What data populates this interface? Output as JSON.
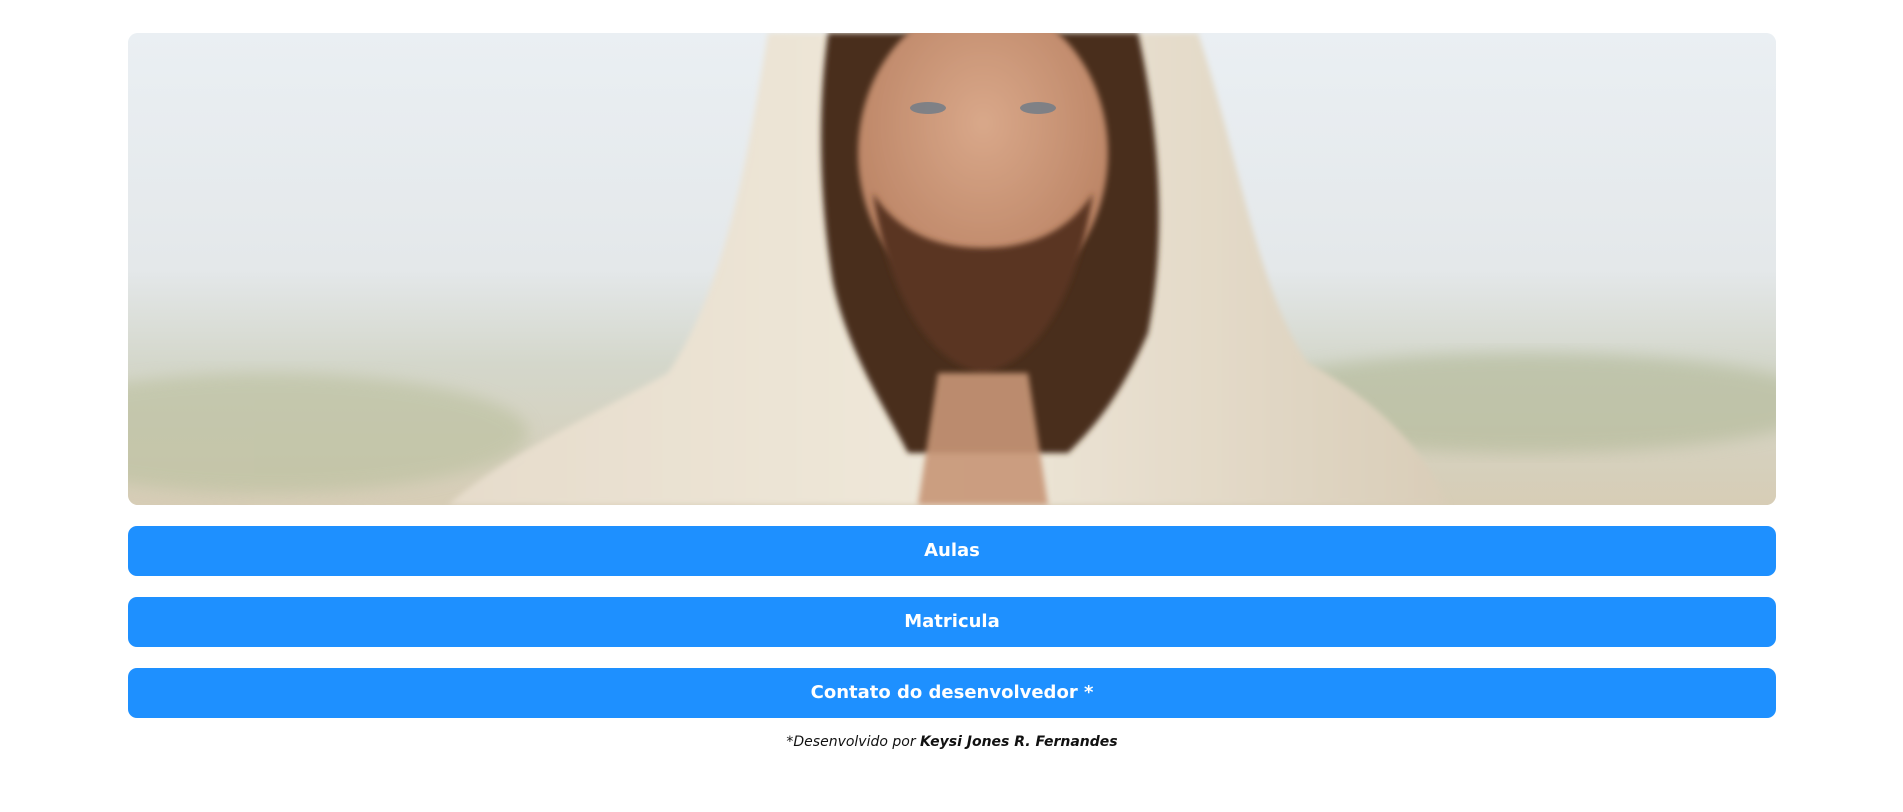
{
  "hero": {
    "image_alt": "Jesus"
  },
  "buttons": {
    "aulas": "Aulas",
    "matricula": "Matricula",
    "contato": "Contato do desenvolvedor *"
  },
  "footer": {
    "prefix": "*Desenvolvido por ",
    "author": "Keysi Jones R. Fernandes"
  },
  "colors": {
    "button": "#1e90ff",
    "button_text": "#ffffff",
    "background": "#ffffff"
  }
}
